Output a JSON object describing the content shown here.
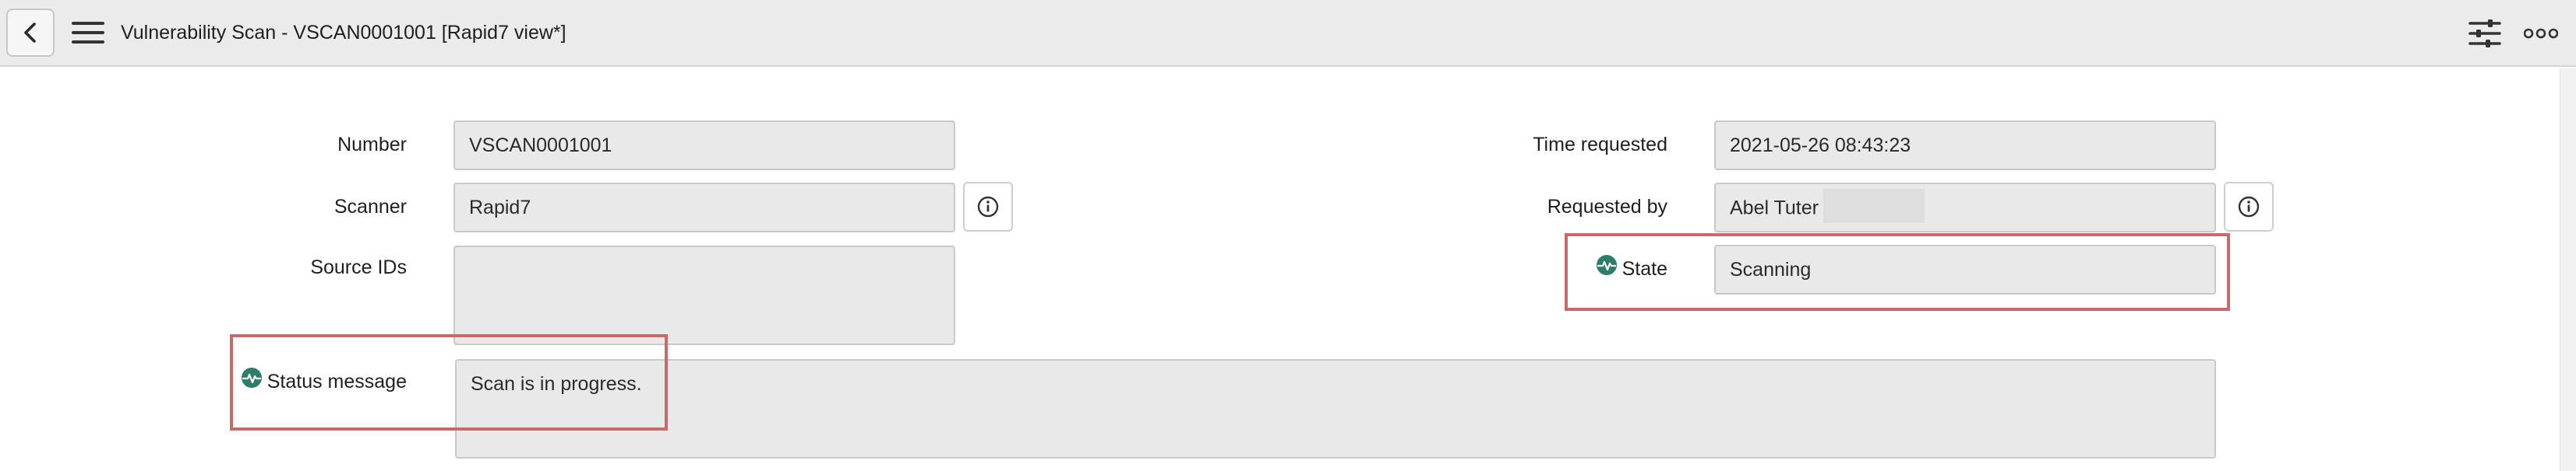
{
  "header": {
    "title": "Vulnerability Scan - VSCAN0001001 [Rapid7 view*]",
    "back_icon": "chevron-left-icon",
    "menu_icon": "hamburger-menu-icon",
    "settings_icon": "sliders-icon",
    "more_icon": "more-options-icon"
  },
  "form": {
    "number": {
      "label": "Number",
      "value": "VSCAN0001001"
    },
    "scanner": {
      "label": "Scanner",
      "value": "Rapid7",
      "info_icon": "info-icon"
    },
    "source_ids": {
      "label": "Source IDs",
      "value": ""
    },
    "status_message": {
      "label": "Status message",
      "value": "Scan is in progress.",
      "icon": "status-pulse-icon"
    },
    "time_requested": {
      "label": "Time requested",
      "value": "2021-05-26 08:43:23"
    },
    "requested_by": {
      "label": "Requested by",
      "value": "Abel Tuter",
      "info_icon": "info-icon"
    },
    "state": {
      "label": "State",
      "value": "Scanning",
      "icon": "status-pulse-icon"
    }
  },
  "colors": {
    "header_bg": "#ebebeb",
    "field_bg": "#e9e9e9",
    "highlight": "#c96a6a",
    "status_icon": "#2e7d6b"
  }
}
